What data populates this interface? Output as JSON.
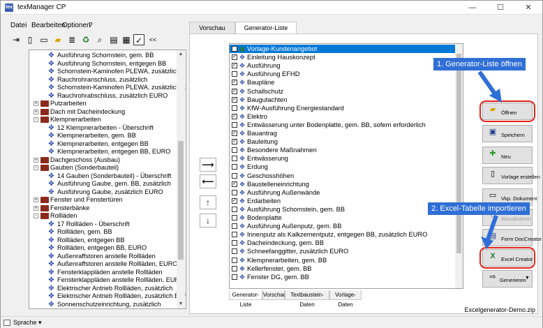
{
  "window": {
    "title": "texManager CP",
    "icon_text": "tex"
  },
  "menu": {
    "items": [
      "Datei",
      "Bearbeiten",
      "Optionen",
      "?"
    ]
  },
  "tree": {
    "items": [
      {
        "label": "Ausführung Schornstein, gem. BB",
        "level": 2,
        "icon": "blueprint-icon"
      },
      {
        "label": "Ausführung Schornstein, entgegen BB",
        "level": 2,
        "icon": "blueprint-icon"
      },
      {
        "label": "Schornstein-Kaminofen PLEWA, zusätzlich",
        "level": 2,
        "icon": "blueprint-icon"
      },
      {
        "label": "Rauchrohranschluss, zusätzlich",
        "level": 2,
        "icon": "blueprint-icon"
      },
      {
        "label": "Schornstein-Kaminofen PLEWA, zusätzlich EUR",
        "level": 2,
        "icon": "blueprint-icon"
      },
      {
        "label": "Rauchrohrabschluss, zusätzlich EURO",
        "level": 2,
        "icon": "blueprint-icon"
      },
      {
        "label": "Putzarbeiten",
        "level": 1,
        "icon": "book-icon",
        "expander": "+"
      },
      {
        "label": "Dach mit Dacheindeckung",
        "level": 1,
        "icon": "book-icon",
        "expander": "+"
      },
      {
        "label": "Klempnerarbeiten",
        "level": 1,
        "icon": "book-icon",
        "expander": "-"
      },
      {
        "label": "12 Klempnerarbeiten - Überschrift",
        "level": 2,
        "icon": "blueprint-icon"
      },
      {
        "label": "Klempnerarbeiten, gem. BB",
        "level": 2,
        "icon": "blueprint-icon"
      },
      {
        "label": "Klempnerarbeiten, entgegen BB",
        "level": 2,
        "icon": "blueprint-icon"
      },
      {
        "label": "Klempnerarbeiten, entgegen BB, EURO",
        "level": 2,
        "icon": "blueprint-icon"
      },
      {
        "label": "Dachgeschoss (Ausbau)",
        "level": 1,
        "icon": "book-icon",
        "expander": "+"
      },
      {
        "label": "Gauben (Sonderbauteil)",
        "level": 1,
        "icon": "book-icon",
        "expander": "-"
      },
      {
        "label": "14 Gauben (Sonderbauteil) - Überschrift",
        "level": 2,
        "icon": "blueprint-icon"
      },
      {
        "label": "Ausführung Gaube, gem. BB, zusätzlich",
        "level": 2,
        "icon": "blueprint-icon"
      },
      {
        "label": "Ausführung Gaube, zusätzlich EURO",
        "level": 2,
        "icon": "blueprint-icon"
      },
      {
        "label": "Fenster und Fenstertüren",
        "level": 1,
        "icon": "book-icon",
        "expander": "+"
      },
      {
        "label": "Fensterbänke",
        "level": 1,
        "icon": "book-icon",
        "expander": "+"
      },
      {
        "label": "Rollläden",
        "level": 1,
        "icon": "book-icon",
        "expander": "-"
      },
      {
        "label": "17 Rollläden - Überschrift",
        "level": 2,
        "icon": "blueprint-icon"
      },
      {
        "label": "Rollläden, gem. BB",
        "level": 2,
        "icon": "blueprint-icon"
      },
      {
        "label": "Rollläden, entgegen BB",
        "level": 2,
        "icon": "blueprint-icon"
      },
      {
        "label": "Rollläden, entgegen BB, EURO",
        "level": 2,
        "icon": "blueprint-icon"
      },
      {
        "label": "Außenraffstoren anstelle Rollläden",
        "level": 2,
        "icon": "blueprint-icon"
      },
      {
        "label": "Außenraffstoren anstelle Rollläden, EURO",
        "level": 2,
        "icon": "blueprint-icon"
      },
      {
        "label": "Fensterklappläden anstelle Rollläden",
        "level": 2,
        "icon": "blueprint-icon"
      },
      {
        "label": "Fensterklappläden anstelle Rollläden, EURO",
        "level": 2,
        "icon": "blueprint-icon"
      },
      {
        "label": "Elektrischer Antrieb Rollläden, zusätzlich",
        "level": 2,
        "icon": "blueprint-icon"
      },
      {
        "label": "Elektrischer Antrieb Rollläden, zusätzlich EURO",
        "level": 2,
        "icon": "blueprint-icon"
      },
      {
        "label": "Sonnenschutzeinrichtung, zusätzlich",
        "level": 2,
        "icon": "blueprint-icon"
      }
    ]
  },
  "top_tabs": [
    {
      "label": "Vorschau",
      "active": false
    },
    {
      "label": "Generator-Liste",
      "active": true
    }
  ],
  "generator_list": {
    "items": [
      {
        "label": "Vorlage-Kundenangebot",
        "checked": true,
        "selected": true
      },
      {
        "label": "Einleitung Hauskonzept",
        "checked": true
      },
      {
        "label": "Ausführung",
        "checked": true
      },
      {
        "label": "Ausführung EFHD",
        "checked": false
      },
      {
        "label": "Baupläne",
        "checked": true
      },
      {
        "label": "Schallschutz",
        "checked": true
      },
      {
        "label": "Baugutachten",
        "checked": true
      },
      {
        "label": "KfW-Ausführung Energiestandard",
        "checked": false
      },
      {
        "label": "Elektro",
        "checked": true
      },
      {
        "label": "Entwässerung unter Bodenplatte, gem. BB, sofern erforderlich",
        "checked": false
      },
      {
        "label": "Bauantrag",
        "checked": true
      },
      {
        "label": "Bauleitung",
        "checked": true
      },
      {
        "label": "Besondere Maßnahmen",
        "checked": false
      },
      {
        "label": "Entwässerung",
        "checked": false
      },
      {
        "label": "Erdung",
        "checked": false
      },
      {
        "label": "Geschosshöhen",
        "checked": false
      },
      {
        "label": "Baustelleneinrichtung",
        "checked": true
      },
      {
        "label": "Ausführung Außenwände",
        "checked": false
      },
      {
        "label": "Erdarbeiten",
        "checked": true
      },
      {
        "label": "Ausführung Schornstein, gem. BB",
        "checked": false
      },
      {
        "label": "Bodenplatte",
        "checked": false
      },
      {
        "label": "Ausführung Außenputz, gem. BB",
        "checked": false
      },
      {
        "label": "Innenputz als Kalkzementputz, entgegen BB, zusätzlich EURO",
        "checked": false
      },
      {
        "label": "Dacheindeckung, gem. BB",
        "checked": false
      },
      {
        "label": "Schneefanggitter, zusätzlich EURO",
        "checked": false
      },
      {
        "label": "Klempnerarbeiten, gem. BB",
        "checked": false
      },
      {
        "label": "Kellerfenster, gem. BB",
        "checked": false
      },
      {
        "label": "Fenster DG, gem. BB",
        "checked": false
      }
    ]
  },
  "bottom_tabs": [
    {
      "label": "Generator-Liste",
      "active": true
    },
    {
      "label": "Vorschau",
      "active": false
    },
    {
      "label": "Textbaustein-Daten",
      "active": false
    },
    {
      "label": "Vorlage-Daten",
      "active": false
    }
  ],
  "buttons": {
    "oeffnen": "Öffnen",
    "speichern": "Speichern",
    "neu": "Neu",
    "vorlage_erstellen": "Vorlage erstellen",
    "vkp_dokument": "Vkp. Dokument",
    "aktualisieren": "Aktualisieren",
    "form_doccreator": "Form DocCreator",
    "excel_creator": "Excel Creator",
    "generieren": "Generieren"
  },
  "callouts": {
    "one": "1. Generator-Liste öffnen",
    "two": "2. Excel-Tabelle importieren"
  },
  "status": {
    "language": "Sprache",
    "filename": "Excelgenerator-Demo.zip"
  },
  "colors": {
    "accent": "#0078d7",
    "callout": "#2f6fd6",
    "highlight": "#e2231a"
  }
}
